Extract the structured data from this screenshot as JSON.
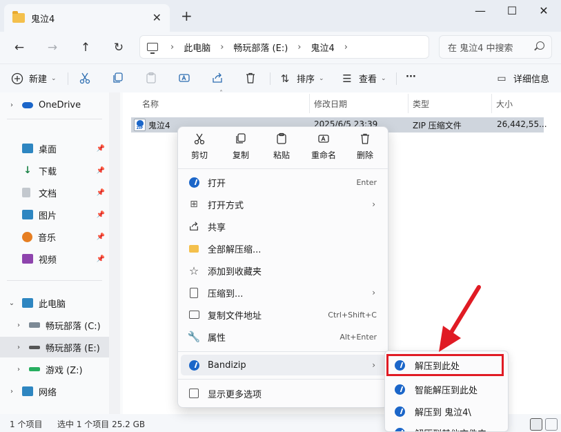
{
  "tab": {
    "title": "鬼泣4",
    "close": "✕",
    "new": "+"
  },
  "window": {
    "minimize": "—",
    "maximize": "☐",
    "close": "✕"
  },
  "nav": {
    "back": "←",
    "forward": "→",
    "up": "↑",
    "refresh": "↻"
  },
  "breadcrumb": {
    "sep": "›",
    "items": [
      "此电脑",
      "畅玩部落 (E:)",
      "鬼泣4"
    ]
  },
  "search": {
    "placeholder": "在 鬼泣4 中搜索"
  },
  "toolbar": {
    "new_label": "新建",
    "sort_label": "排序",
    "view_label": "查看",
    "more_label": "···",
    "details_label": "详细信息"
  },
  "sidebar": {
    "items": [
      {
        "label": "OneDrive",
        "icon": "cloud-icon",
        "color": "#1b66c9"
      },
      {
        "label": "桌面",
        "icon": "desktop-icon",
        "color": "#2e86c1"
      },
      {
        "label": "下载",
        "icon": "download-icon",
        "color": "#1e8449"
      },
      {
        "label": "文档",
        "icon": "document-icon",
        "color": "#7f8c8d"
      },
      {
        "label": "图片",
        "icon": "picture-icon",
        "color": "#2e86c1"
      },
      {
        "label": "音乐",
        "icon": "music-icon",
        "color": "#e67e22"
      },
      {
        "label": "视频",
        "icon": "video-icon",
        "color": "#8e44ad"
      },
      {
        "label": "此电脑",
        "icon": "pc-icon",
        "color": "#2e86c1"
      },
      {
        "label": "畅玩部落 (C:)",
        "icon": "drive-icon",
        "color": "#555555"
      },
      {
        "label": "畅玩部落 (E:)",
        "icon": "drive-icon",
        "color": "#555555"
      },
      {
        "label": "游戏 (Z:)",
        "icon": "drive-icon",
        "color": "#27ae60"
      },
      {
        "label": "网络",
        "icon": "network-icon",
        "color": "#2e86c1"
      }
    ]
  },
  "columns": {
    "name": "名称",
    "modified": "修改日期",
    "type": "类型",
    "size": "大小"
  },
  "file": {
    "name": "鬼泣4",
    "modified": "2025/6/5 23:39",
    "type": "ZIP 压缩文件",
    "size": "26,442,55..."
  },
  "status": {
    "count": "1 个项目",
    "selected": "选中 1 个项目 25.2 GB"
  },
  "context_menu": {
    "top_actions": [
      "剪切",
      "复制",
      "粘贴",
      "重命名",
      "删除"
    ],
    "items": [
      {
        "label": "打开",
        "shortcut": "Enter",
        "icon": "bandizip-icon"
      },
      {
        "label": "打开方式",
        "shortcut": "",
        "icon": "open-with-icon"
      },
      {
        "label": "共享",
        "shortcut": "",
        "icon": "share-icon"
      },
      {
        "label": "全部解压缩...",
        "shortcut": "",
        "icon": "extract-icon"
      },
      {
        "label": "添加到收藏夹",
        "shortcut": "",
        "icon": "star-icon"
      },
      {
        "label": "压缩到...",
        "shortcut": "",
        "icon": "compress-icon"
      },
      {
        "label": "复制文件地址",
        "shortcut": "Ctrl+Shift+C",
        "icon": "copy-path-icon"
      },
      {
        "label": "属性",
        "shortcut": "Alt+Enter",
        "icon": "wrench-icon"
      },
      {
        "label": "Bandizip",
        "shortcut": "",
        "icon": "bandizip-icon"
      },
      {
        "label": "显示更多选项",
        "shortcut": "",
        "icon": "more-options-icon"
      }
    ],
    "arrow": "›"
  },
  "submenu": {
    "items": [
      "解压到此处",
      "智能解压到此处",
      "解压到 鬼泣4\\",
      "解压到其他文件夹..."
    ]
  },
  "colors": {
    "accent": "#1b66c9",
    "highlight": "#e01b24",
    "selection": "#cfd5dd"
  }
}
